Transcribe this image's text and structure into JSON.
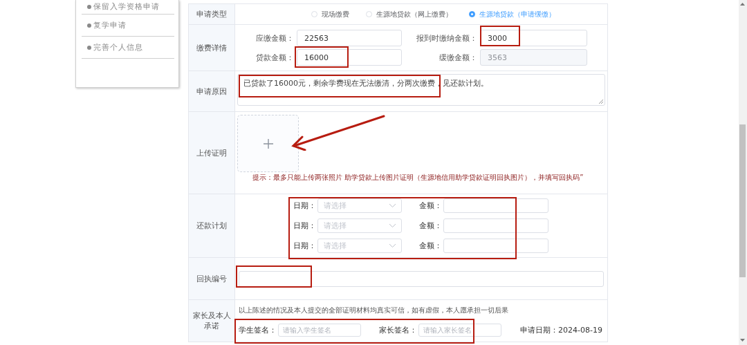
{
  "sidebar": {
    "items": [
      {
        "label": "保留入学资格申请"
      },
      {
        "label": "复学申请"
      },
      {
        "label": "完善个人信息"
      }
    ]
  },
  "form": {
    "rows": [
      {
        "kind": "radio",
        "label": "申请类型",
        "options": [
          {
            "label": "现场缴费",
            "selected": false
          },
          {
            "label": "生源地贷款（网上缴费）",
            "selected": false
          },
          {
            "label": "生源地贷款（申请缓缴）",
            "selected": true
          }
        ]
      },
      {
        "kind": "fees",
        "label": "缴费详情",
        "fields": [
          {
            "label": "应缴金额：",
            "value": "22563",
            "disabled": false,
            "highlighted": false
          },
          {
            "label": "报到时缴纳金额：",
            "value": "3000",
            "disabled": false,
            "highlighted": true
          },
          {
            "label": "贷款金额：",
            "value": "16000",
            "disabled": false,
            "highlighted": true
          },
          {
            "label": "缓缴金额：",
            "value": "3563",
            "disabled": true,
            "highlighted": false
          }
        ]
      },
      {
        "kind": "textarea",
        "label": "申请原因",
        "value": "已贷款了16000元，剩余学费现在无法缴清，分两次缴费，见还款计划。",
        "highlighted": true
      },
      {
        "kind": "upload",
        "label": "上传证明",
        "hint": "提示：最多只能上传两张照片 助学贷款上传图片证明（生源地信用助学贷款证明回执图片），并填写回执码”",
        "arrow": true
      },
      {
        "kind": "plan",
        "label": "还款计划",
        "highlighted": true,
        "entries": [
          {
            "date_label": "日期：",
            "date_placeholder": "请选择",
            "amount_label": "金额："
          },
          {
            "date_label": "日期：",
            "date_placeholder": "请选择",
            "amount_label": "金额："
          },
          {
            "date_label": "日期：",
            "date_placeholder": "请选择",
            "amount_label": "金额："
          }
        ]
      },
      {
        "kind": "text",
        "label": "回执编号",
        "highlighted": true
      },
      {
        "kind": "pledge",
        "label": "家长及本人承诺",
        "statement": "以上陈述的情况及本人提交的全部证明材料均真实可信，如有虚假，本人愿承担一切后果",
        "signatures_highlighted": true,
        "signatures": [
          {
            "label": "学生签名：",
            "placeholder": "请输入学生签名"
          },
          {
            "label": "家长签名：",
            "placeholder": "请输入家长签名"
          }
        ],
        "date_label": "申请日期：",
        "date": "2024-08-19"
      }
    ]
  }
}
